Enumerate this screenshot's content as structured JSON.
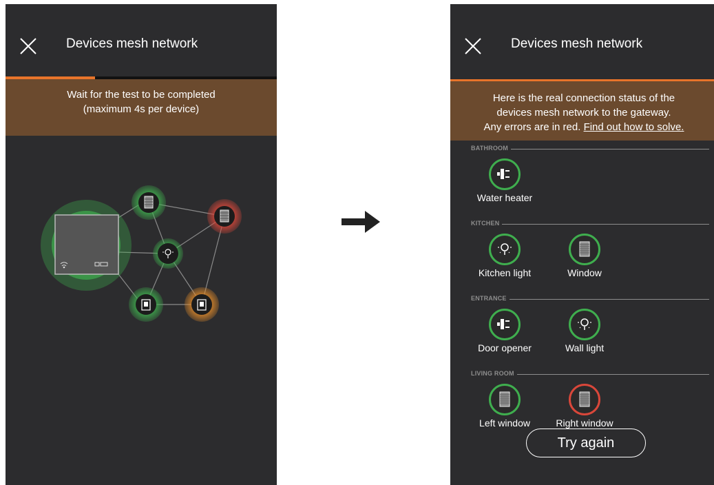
{
  "left_screen": {
    "title": "Devices mesh network",
    "progress_fraction": 0.33,
    "banner_line1": "Wait for the test to be completed",
    "banner_line2": "(maximum 4s per device)"
  },
  "right_screen": {
    "title": "Devices mesh network",
    "progress_fraction": 1.0,
    "banner_line1": "Here is the real connection status of the",
    "banner_line2": "devices mesh network to the gateway.",
    "banner_line3_prefix": "Any errors are in red.",
    "banner_link": "Find out how to solve.",
    "rooms": [
      {
        "label": "BATHROOM",
        "devices": [
          {
            "label": "Water heater",
            "icon": "plug-icon",
            "status": "ok"
          }
        ]
      },
      {
        "label": "KITCHEN",
        "devices": [
          {
            "label": "Kitchen light",
            "icon": "light-bulb-icon",
            "status": "ok"
          },
          {
            "label": "Window",
            "icon": "window-blind-icon",
            "status": "ok"
          }
        ]
      },
      {
        "label": "ENTRANCE",
        "devices": [
          {
            "label": "Door opener",
            "icon": "plug-icon",
            "status": "ok"
          },
          {
            "label": "Wall light",
            "icon": "light-bulb-icon",
            "status": "ok"
          }
        ]
      },
      {
        "label": "LIVING ROOM",
        "devices": [
          {
            "label": "Left window",
            "icon": "window-blind-icon",
            "status": "ok"
          },
          {
            "label": "Right window",
            "icon": "window-blind-icon",
            "status": "error"
          }
        ]
      }
    ],
    "try_again_label": "Try again"
  },
  "colors": {
    "ok": "#3fae4e",
    "error": "#d9473a",
    "warning": "#e08a2a",
    "accent": "#e8742a",
    "banner": "#6b4a2e"
  }
}
